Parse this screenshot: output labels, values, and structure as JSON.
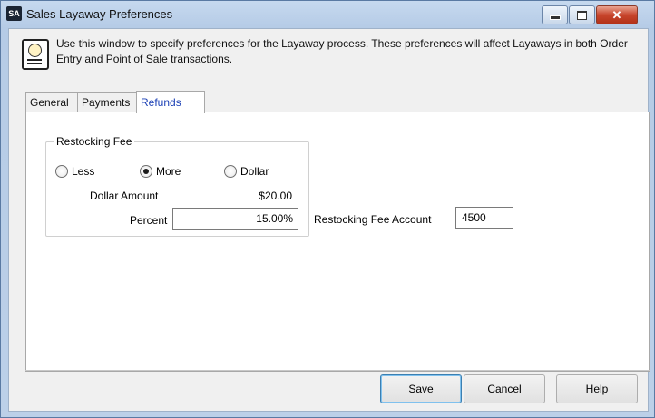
{
  "window": {
    "app_icon_text": "SA",
    "title": "Sales Layaway Preferences"
  },
  "header": {
    "icon": "document-info-icon",
    "description": "Use this window to specify preferences for the Layaway process. These preferences will affect Layaways in both Order Entry and Point of Sale transactions."
  },
  "tabs": [
    {
      "label": "General",
      "active": false
    },
    {
      "label": "Payments",
      "active": false
    },
    {
      "label": "Refunds",
      "active": true
    }
  ],
  "refunds": {
    "restocking_fee_group": "Restocking Fee",
    "radio_options": [
      {
        "label": "Less",
        "checked": false
      },
      {
        "label": "More",
        "checked": true
      },
      {
        "label": "Dollar",
        "checked": false
      }
    ],
    "dollar_amount_label": "Dollar Amount",
    "dollar_amount_value": "$20.00",
    "percent_label": "Percent",
    "percent_value": "15.00%",
    "account_label": "Restocking Fee Account",
    "account_value": "4500"
  },
  "buttons": {
    "save": "Save",
    "cancel": "Cancel",
    "help": "Help"
  }
}
